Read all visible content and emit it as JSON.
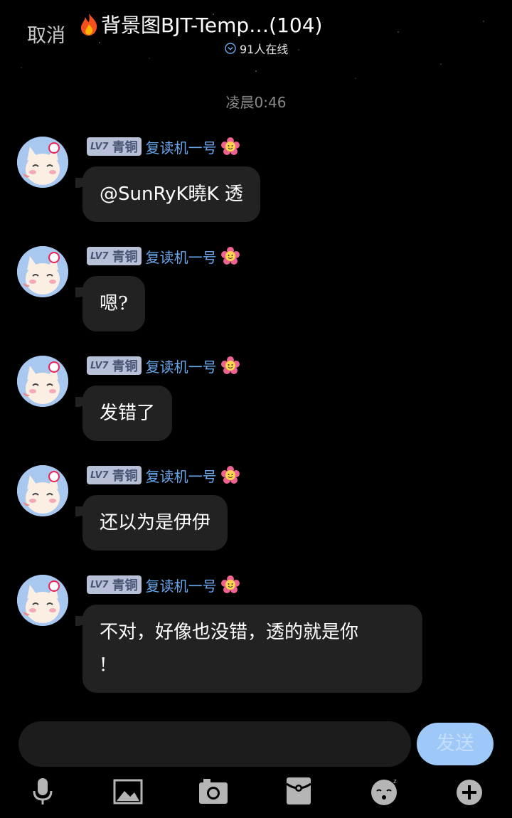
{
  "header": {
    "cancel_label": "取消",
    "title": "背景图BJT-Temp…(104)",
    "online_text": "91人在线"
  },
  "timestamp": "凌晨0:46",
  "messages": [
    {
      "level": "LV7",
      "rank": "青铜",
      "nickname": "复读机一号",
      "text": "@SunRyK曉K 透"
    },
    {
      "level": "LV7",
      "rank": "青铜",
      "nickname": "复读机一号",
      "text": "嗯?"
    },
    {
      "level": "LV7",
      "rank": "青铜",
      "nickname": "复读机一号",
      "text": "发错了"
    },
    {
      "level": "LV7",
      "rank": "青铜",
      "nickname": "复读机一号",
      "text": "还以为是伊伊"
    },
    {
      "level": "LV7",
      "rank": "青铜",
      "nickname": "复读机一号",
      "text_line1": "不对，好像也没错，透的就是你",
      "text_line2": "!"
    }
  ],
  "input": {
    "send_label": "发送"
  },
  "toolbar": [
    "microphone-icon",
    "image-icon",
    "camera-icon",
    "red-packet-icon",
    "emoji-icon",
    "plus-icon"
  ]
}
